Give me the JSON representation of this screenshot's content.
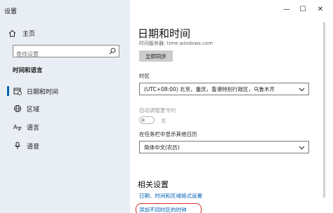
{
  "window": {
    "title": "设置",
    "minimize": "—",
    "maximize": "☐",
    "close": "✕"
  },
  "sidebar": {
    "home_label": "主页",
    "search_placeholder": "查找设置",
    "section_title": "时间和语言",
    "items": [
      {
        "label": "日期和时间",
        "icon": "calendar-clock-icon",
        "active": true
      },
      {
        "label": "区域",
        "icon": "globe-icon",
        "active": false
      },
      {
        "label": "语言",
        "icon": "language-icon",
        "active": false
      },
      {
        "label": "语音",
        "icon": "microphone-icon",
        "active": false
      }
    ]
  },
  "main": {
    "title": "日期和时间",
    "time_server": "时间服务器: time.windows.com",
    "sync_button": "立即同步",
    "timezone_label": "时区",
    "timezone_value": "(UTC+08:00) 北京，重庆，香港特别行政区，乌鲁木齐",
    "dst_label": "自动调整夏令时",
    "dst_toggle_state": "关",
    "calendar_label": "在任务栏中显示其他日历",
    "calendar_value": "简体中文(农历)",
    "related_title": "相关设置",
    "link_region_formats": "日期、时间和区域格式设置",
    "link_add_clocks": "添加不同时区的时钟"
  },
  "colors": {
    "accent": "#0063b1",
    "link": "#0060b6",
    "highlight": "#d52b2b"
  }
}
